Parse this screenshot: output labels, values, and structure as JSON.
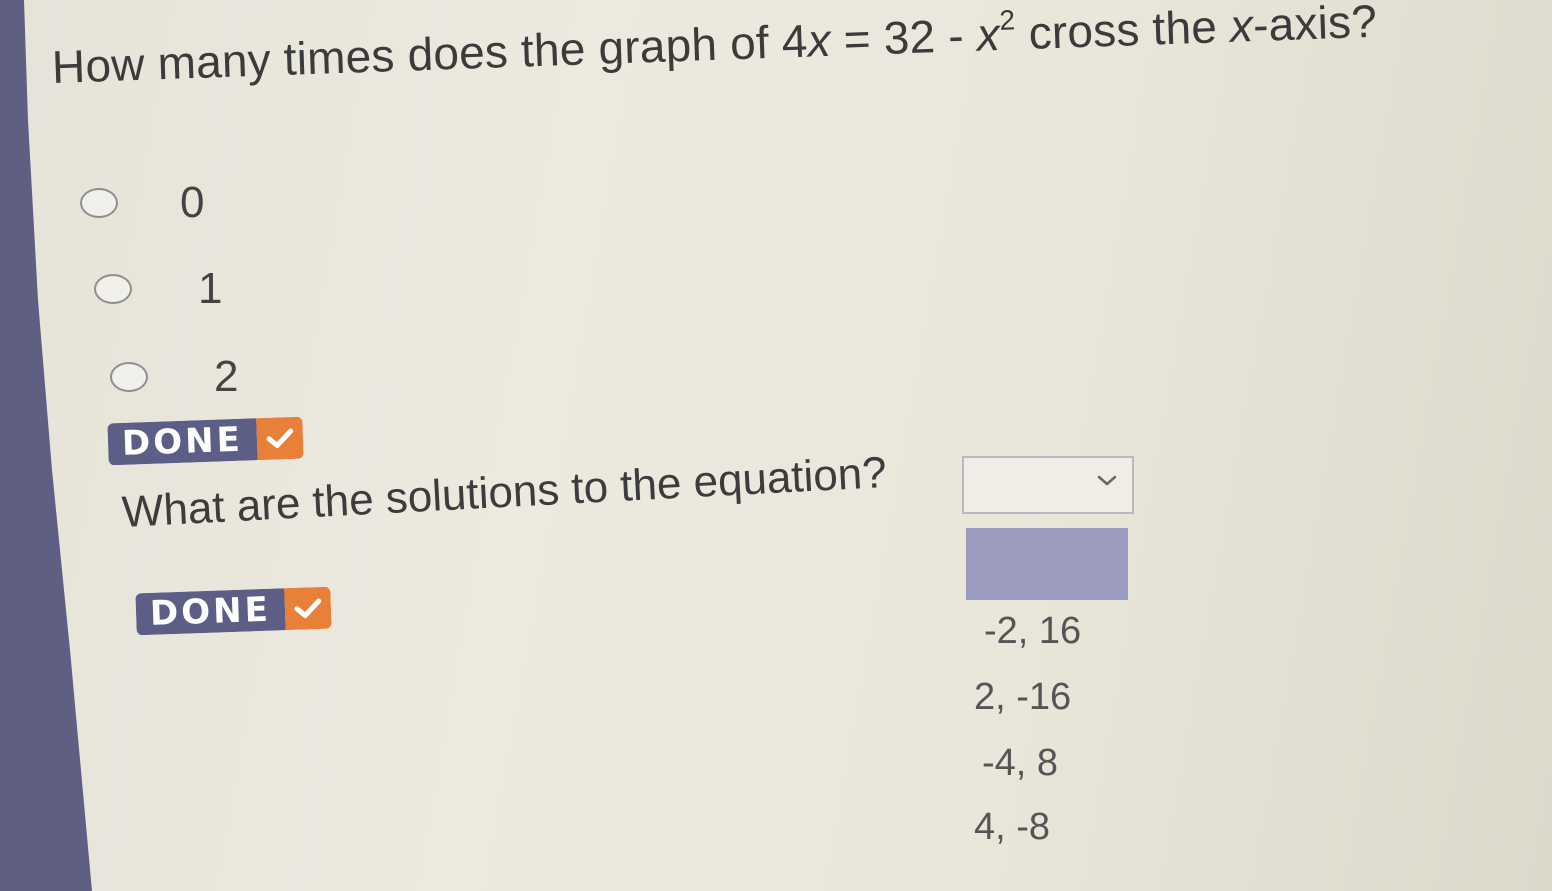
{
  "question1": {
    "prefix": "How many times does the graph of ",
    "equation_lhs": "4",
    "equation_var1": "x",
    "equation_mid": " = 32 - ",
    "equation_var2": "x",
    "equation_exp": "2",
    "suffix_start": " cross the ",
    "suffix_var": "x",
    "suffix_end": "-axis?",
    "options": [
      "0",
      "1",
      "2"
    ]
  },
  "done_button": {
    "label": "DONE",
    "icon": "checkmark-icon"
  },
  "question2": {
    "text": "What are the solutions to the equation?",
    "dropdown": {
      "selected": "",
      "options": [
        "-2, 16",
        "2, -16",
        "-4, 8",
        "4, -8"
      ]
    }
  },
  "colors": {
    "accent_purple": "#5d5e86",
    "check_orange": "#e8803a",
    "highlight": "#9b9bbf"
  }
}
